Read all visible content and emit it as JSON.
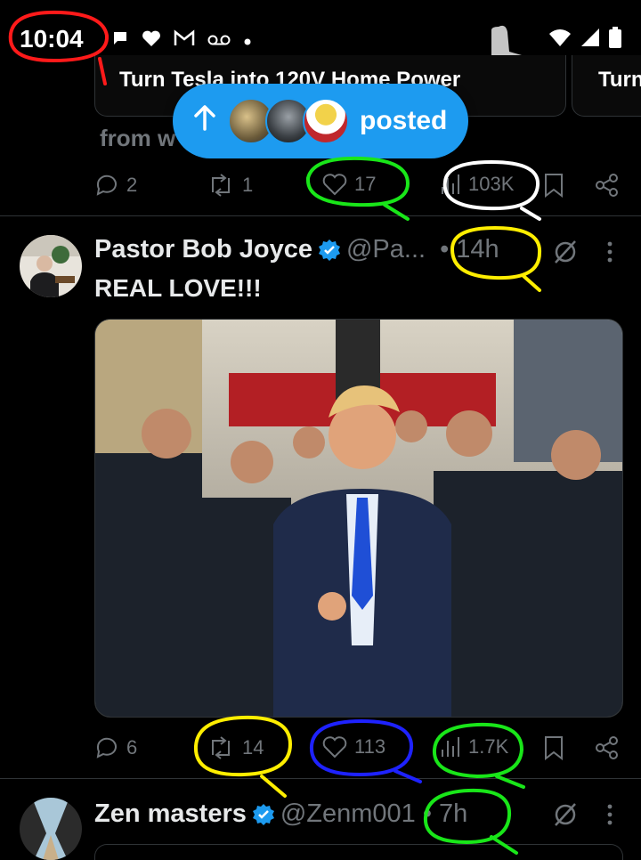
{
  "status_bar": {
    "time": "10:04",
    "icons": [
      "chat-icon",
      "heart-icon",
      "gmail-icon",
      "voicemail-icon",
      "dot-icon"
    ]
  },
  "previous_post": {
    "card_title": "Turn Tesla into 120V Home Power",
    "card_title_2": "Turn",
    "from_text": "from w",
    "actions": {
      "replies": "2",
      "reposts": "1",
      "likes": "17",
      "views": "103K"
    }
  },
  "posted_pill": {
    "label": "posted"
  },
  "post": {
    "author_name": "Pastor Bob Joyce",
    "handle": "@Pa...",
    "time": "• 14h",
    "text": "REAL LOVE!!!",
    "actions": {
      "replies": "6",
      "reposts": "14",
      "likes": "113",
      "views": "1.7K"
    }
  },
  "next_post": {
    "author_name": "Zen masters",
    "handle": "@Zenm001",
    "time": "• 7h"
  },
  "colors": {
    "accent": "#1d9bf0",
    "background": "#000000",
    "muted": "#71767b",
    "annotation_red": "#ff1a1a",
    "annotation_green": "#19e619",
    "annotation_yellow": "#ffee00",
    "annotation_blue": "#1e22ff",
    "annotation_white": "#ffffff"
  }
}
